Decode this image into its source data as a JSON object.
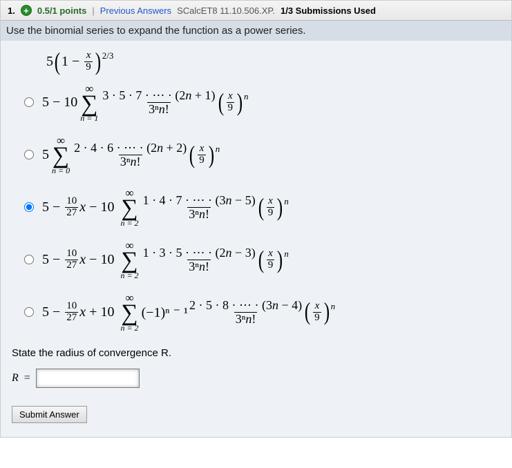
{
  "header": {
    "question_number": "1.",
    "points": "0.5/1 points",
    "divider": "|",
    "prev_answers": "Previous Answers",
    "assignment": "SCalcET8 11.10.506.XP.",
    "submissions_used": "1/3 Submissions Used"
  },
  "prompt": "Use the binomial series to expand the function as a power series.",
  "expression": {
    "lead": "5",
    "inner_lead": "1 − ",
    "frac_num": "x",
    "frac_den": "9",
    "exp": "2/3"
  },
  "choices": [
    {
      "selected": false,
      "prefix": "5 − 10",
      "sum_lb": "n = 1",
      "num": "3 · 5 · 7 · ⋯ · (2n + 1)",
      "den": "3ⁿn!",
      "tail_num": "x",
      "tail_den": "9",
      "tail_exp": "n",
      "extra": ""
    },
    {
      "selected": false,
      "prefix": "5",
      "sum_lb": "n = 0",
      "num": "2 · 4 · 6 · ⋯ · (2n + 2)",
      "den": "3ⁿn!",
      "tail_num": "x",
      "tail_den": "9",
      "tail_exp": "n",
      "extra": ""
    },
    {
      "selected": true,
      "prefix": "5 − ",
      "pf_num": "10",
      "pf_den": "27",
      "pf_tail": "x − 10",
      "sum_lb": "n = 2",
      "num": "1 · 4 · 7 · ⋯ · (3n − 5)",
      "den": "3ⁿn!",
      "tail_num": "x",
      "tail_den": "9",
      "tail_exp": "n",
      "extra": ""
    },
    {
      "selected": false,
      "prefix": "5 − ",
      "pf_num": "10",
      "pf_den": "27",
      "pf_tail": "x − 10",
      "sum_lb": "n = 2",
      "num": "1 · 3 · 5 · ⋯ · (2n − 3)",
      "den": "3ⁿn!",
      "tail_num": "x",
      "tail_den": "9",
      "tail_exp": "n",
      "extra": ""
    },
    {
      "selected": false,
      "prefix": "5 − ",
      "pf_num": "10",
      "pf_den": "27",
      "pf_tail": "x + 10",
      "sum_lb": "n = 2",
      "extra": "(−1)ⁿ ⁻ ¹",
      "num": "2 · 5 · 8 · ⋯ · (3n − 4)",
      "den": "3ⁿn!",
      "tail_num": "x",
      "tail_den": "9",
      "tail_exp": "n"
    }
  ],
  "state_radius": "State the radius of convergence R.",
  "radius_label": "R",
  "radius_eq": "=",
  "radius_value": "",
  "submit_label": "Submit Answer"
}
